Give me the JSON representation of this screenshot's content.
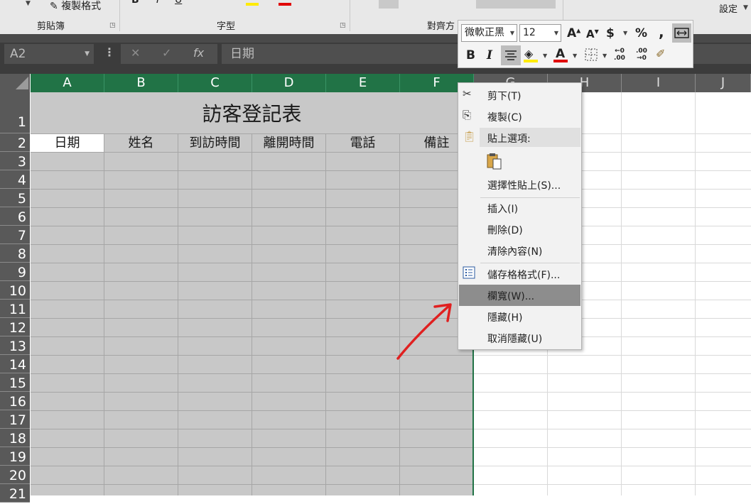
{
  "ribbon": {
    "clipboard_label": "剪貼簿",
    "format_painter_label": "複製格式",
    "font_label": "字型",
    "align_label": "對齊方",
    "settings_label": "設定",
    "merge_label": "跨欄置中"
  },
  "formula_bar": {
    "name_box": "A2",
    "cancel_icon": "✕",
    "enter_icon": "✓",
    "fx_label": "fx",
    "content": "日期"
  },
  "columns": [
    "A",
    "B",
    "C",
    "D",
    "E",
    "F",
    "G",
    "H",
    "I",
    "J"
  ],
  "rows": [
    "1",
    "2",
    "3",
    "4",
    "5",
    "6",
    "7",
    "8",
    "9",
    "10",
    "11",
    "12",
    "13",
    "14",
    "15",
    "16",
    "17",
    "18",
    "19",
    "20",
    "21"
  ],
  "sheet": {
    "title": "訪客登記表",
    "headers": [
      "日期",
      "姓名",
      "到訪時間",
      "離開時間",
      "電話",
      "備註"
    ]
  },
  "mini_toolbar": {
    "font_name": "微軟正黑",
    "font_size": "12",
    "grow_font": "A",
    "shrink_font": "A",
    "currency": "$",
    "percent": "%",
    "comma": ",",
    "bold": "B",
    "italic": "I",
    "font_color": "A",
    "inc_decimal_top": "←0",
    "inc_decimal_bottom": ".00",
    "dec_decimal_top": ".00",
    "dec_decimal_bottom": "→0"
  },
  "context_menu": {
    "cut": "剪下(T)",
    "copy": "複製(C)",
    "paste_options": "貼上選項:",
    "paste_special": "選擇性貼上(S)...",
    "insert": "插入(I)",
    "delete": "刪除(D)",
    "clear": "清除內容(N)",
    "format_cells": "儲存格格式(F)...",
    "column_width": "欄寬(W)...",
    "hide": "隱藏(H)",
    "unhide": "取消隱藏(U)"
  },
  "colors": {
    "excel_green": "#217346",
    "selection_fill": "#c8c8c8",
    "highlight": "#8d8d8d",
    "annotation_red": "#e02020"
  }
}
